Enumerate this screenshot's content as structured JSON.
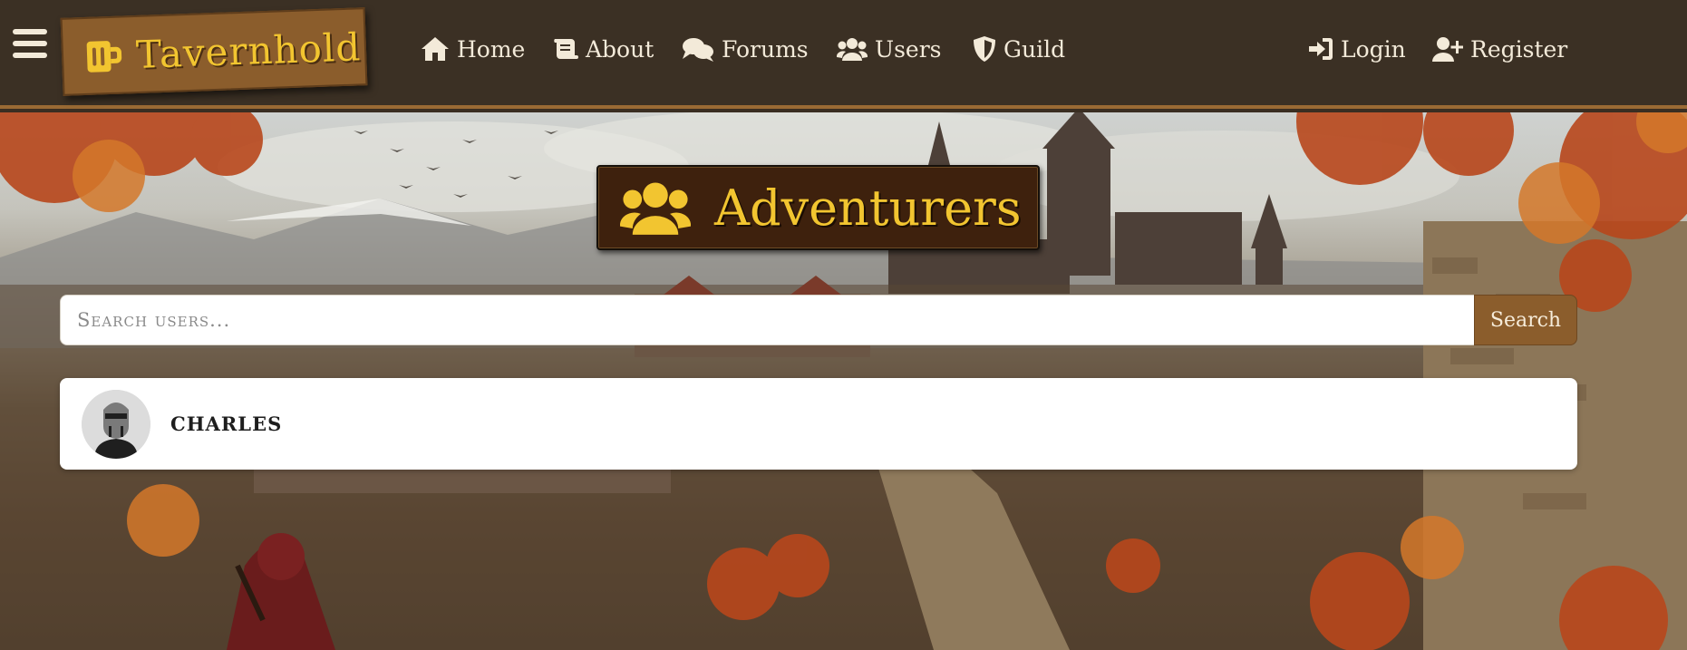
{
  "navbar": {
    "brand": {
      "name": "Tavernhold",
      "icon": "mug-icon"
    },
    "menu_icon": "hamburger-icon",
    "items": [
      {
        "label": "Home",
        "icon": "home-icon"
      },
      {
        "label": "About",
        "icon": "scroll-icon"
      },
      {
        "label": "Forums",
        "icon": "comments-icon"
      },
      {
        "label": "Users",
        "icon": "users-icon"
      },
      {
        "label": "Guild",
        "icon": "shield-icon"
      }
    ],
    "auth": [
      {
        "label": "Login",
        "icon": "login-icon"
      },
      {
        "label": "Register",
        "icon": "user-plus-icon"
      }
    ]
  },
  "page": {
    "title": "Adventurers",
    "title_icon": "users-icon"
  },
  "search": {
    "placeholder": "Search users...",
    "value": "",
    "button_label": "Search"
  },
  "users": [
    {
      "name": "CHARLES",
      "avatar": "knight-helmet-avatar"
    }
  ],
  "colors": {
    "navbar_bg": "#3b3024",
    "accent_brown": "#8b5d2c",
    "gold": "#f2c530",
    "title_bg": "#3e210d",
    "nav_text": "#f3ead9"
  }
}
